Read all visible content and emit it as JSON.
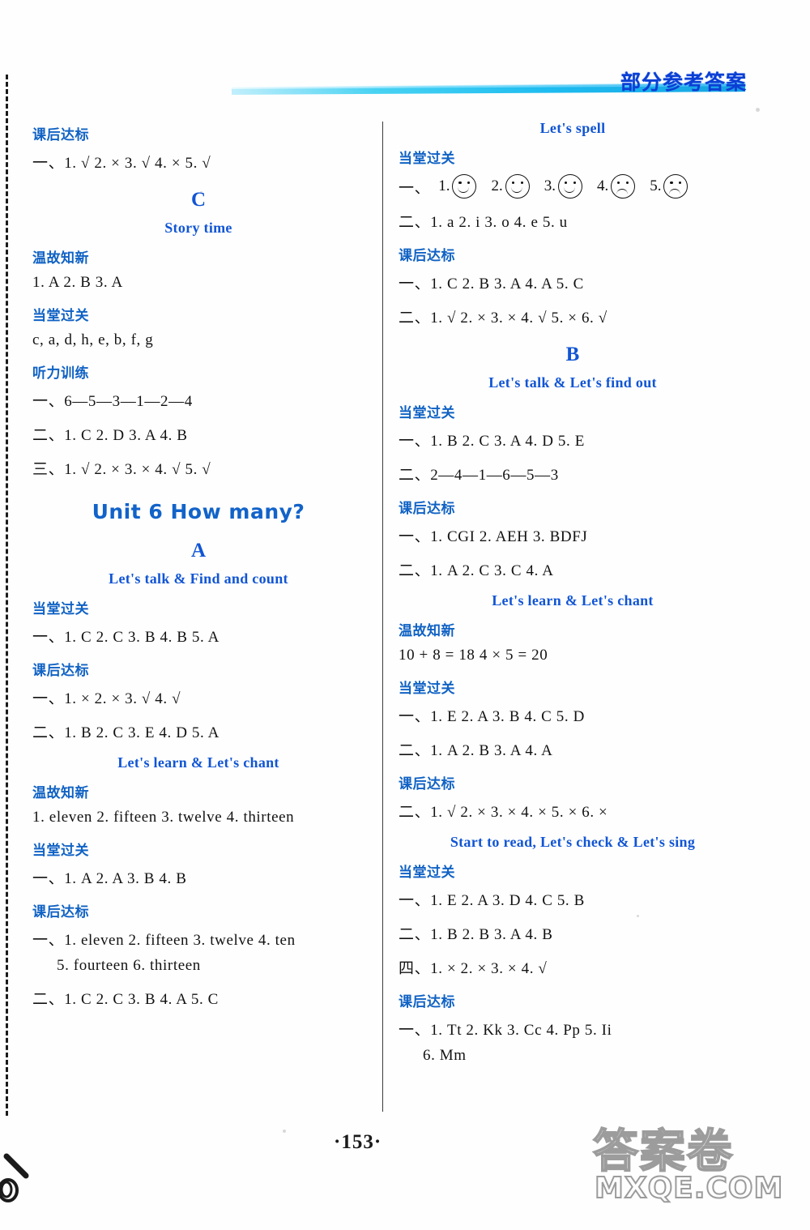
{
  "page": {
    "header_title": "部分参考答案",
    "page_number": "·153·",
    "watermark_line1": "答案卷",
    "watermark_line2": "MXQE.COM",
    "accent_blue": "#1062c4",
    "title_blue": "#0b3fd4",
    "band_cyan": "#12b8ef"
  },
  "left_column": {
    "blocks": [
      {
        "type": "section_head",
        "text": "课后达标"
      },
      {
        "type": "answer",
        "text": "一、1. √  2. ×  3. √  4. ×  5. √"
      },
      {
        "type": "big_letter",
        "text": "C"
      },
      {
        "type": "sub_title",
        "text": "Story time"
      },
      {
        "type": "section_head",
        "text": "温故知新"
      },
      {
        "type": "answer",
        "text": "1. A  2. B  3. A"
      },
      {
        "type": "section_head",
        "text": "当堂过关"
      },
      {
        "type": "answer",
        "text": "c, a, d, h, e, b, f, g"
      },
      {
        "type": "section_head",
        "text": "听力训练"
      },
      {
        "type": "answer",
        "text": "一、6—5—3—1—2—4"
      },
      {
        "type": "answer",
        "text": "二、1. C  2. D  3. A  4. B"
      },
      {
        "type": "answer",
        "text": "三、1. √  2. ×  3. ×  4. √  5. √"
      },
      {
        "type": "unit_title",
        "text": "Unit 6   How many?"
      },
      {
        "type": "big_letter",
        "text": "A"
      },
      {
        "type": "sub_title",
        "text": "Let's talk & Find and count"
      },
      {
        "type": "section_head",
        "text": "当堂过关"
      },
      {
        "type": "answer",
        "text": "一、1. C  2. C  3. B  4. B  5. A"
      },
      {
        "type": "section_head",
        "text": "课后达标"
      },
      {
        "type": "answer",
        "text": "一、1. ×  2. ×  3. √  4. √"
      },
      {
        "type": "answer",
        "text": "二、1. B  2. C  3. E  4. D  5. A"
      },
      {
        "type": "sub_title",
        "text": "Let's learn & Let's chant"
      },
      {
        "type": "section_head",
        "text": "温故知新"
      },
      {
        "type": "answer",
        "text": "1. eleven  2. fifteen  3. twelve  4. thirteen"
      },
      {
        "type": "section_head",
        "text": "当堂过关"
      },
      {
        "type": "answer",
        "text": "一、1. A  2. A  3. B  4. B"
      },
      {
        "type": "section_head",
        "text": "课后达标"
      },
      {
        "type": "answer",
        "text": "一、1. eleven  2. fifteen  3. twelve  4. ten"
      },
      {
        "type": "answer_indent",
        "text": "5. fourteen  6. thirteen"
      },
      {
        "type": "answer",
        "text": "二、1. C  2. C  3. B  4. A  5. C"
      }
    ]
  },
  "right_column": {
    "blocks": [
      {
        "type": "sub_title",
        "text": "Let's spell"
      },
      {
        "type": "section_head",
        "text": "当堂过关"
      },
      {
        "type": "faces",
        "label": "一、",
        "items": [
          {
            "num": "1.",
            "mood": "happy"
          },
          {
            "num": "2.",
            "mood": "happy"
          },
          {
            "num": "3.",
            "mood": "happy"
          },
          {
            "num": "4.",
            "mood": "sad"
          },
          {
            "num": "5.",
            "mood": "sad"
          }
        ]
      },
      {
        "type": "answer",
        "text": "二、1. a  2. i  3. o  4. e  5. u"
      },
      {
        "type": "section_head",
        "text": "课后达标"
      },
      {
        "type": "answer",
        "text": "一、1. C  2. B  3. A  4. A  5. C"
      },
      {
        "type": "answer",
        "text": "二、1. √  2. ×  3. ×  4. √  5. ×  6. √"
      },
      {
        "type": "big_letter",
        "text": "B"
      },
      {
        "type": "sub_title",
        "text": "Let's talk & Let's find out"
      },
      {
        "type": "section_head",
        "text": "当堂过关"
      },
      {
        "type": "answer",
        "text": "一、1. B  2. C  3. A  4. D  5. E"
      },
      {
        "type": "answer",
        "text": "二、2—4—1—6—5—3"
      },
      {
        "type": "section_head",
        "text": "课后达标"
      },
      {
        "type": "answer",
        "text": "一、1. CGI   2. AEH   3. BDFJ"
      },
      {
        "type": "answer",
        "text": "二、1. A  2. C  3. C  4. A"
      },
      {
        "type": "sub_title",
        "text": "Let's learn & Let's chant"
      },
      {
        "type": "section_head",
        "text": "温故知新"
      },
      {
        "type": "answer",
        "text": "10 + 8 = 18    4 × 5 = 20"
      },
      {
        "type": "section_head",
        "text": "当堂过关"
      },
      {
        "type": "answer",
        "text": "一、1. E  2. A  3. B  4. C  5. D"
      },
      {
        "type": "answer",
        "text": "二、1. A  2. B  3. A  4. A"
      },
      {
        "type": "section_head",
        "text": "课后达标"
      },
      {
        "type": "answer",
        "text": "二、1. √  2. ×  3. ×  4. ×  5. ×  6. ×"
      },
      {
        "type": "sub_title",
        "text": "Start to read, Let's check & Let's sing"
      },
      {
        "type": "section_head",
        "text": "当堂过关"
      },
      {
        "type": "answer",
        "text": "一、1. E  2. A  3. D  4. C  5. B"
      },
      {
        "type": "answer",
        "text": "二、1. B  2. B  3. A  4. B"
      },
      {
        "type": "answer",
        "text": "四、1. ×  2. ×  3. ×  4. √"
      },
      {
        "type": "section_head",
        "text": "课后达标"
      },
      {
        "type": "answer",
        "text": "一、1. Tt  2. Kk  3. Cc  4. Pp  5. Ii"
      },
      {
        "type": "answer_indent",
        "text": "6. Mm"
      }
    ]
  }
}
